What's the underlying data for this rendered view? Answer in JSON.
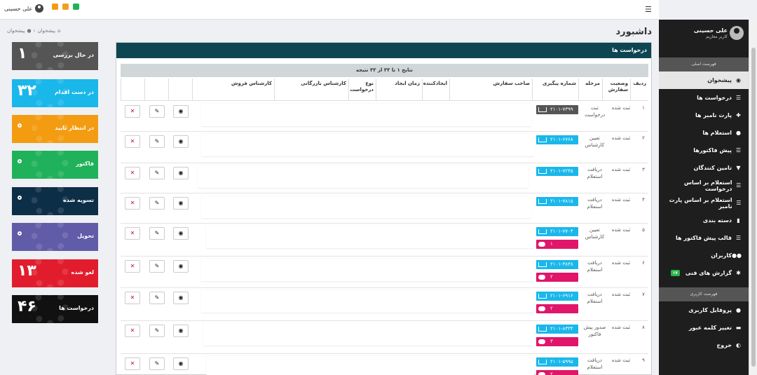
{
  "topbar": {
    "user_name": "علی حسینی"
  },
  "header": {
    "page_title": "داشبورد",
    "breadcrumb": [
      "پیشخوان",
      "پیشخوان"
    ]
  },
  "sidebar": {
    "user_name": "علی حسینی",
    "user_role": "کاربر معازیم",
    "section_main": "فهرست اصلی",
    "section_user": "فهرست کاربری",
    "items": [
      {
        "label": "پیشخوان",
        "icon": "dashboard-icon"
      },
      {
        "label": "درخواست ها",
        "icon": "list-icon"
      },
      {
        "label": "پارت نامبر ها",
        "icon": "puzzle-icon"
      },
      {
        "label": "استعلام ها",
        "icon": "user-icon"
      },
      {
        "label": "پیش فاکتورها",
        "icon": "list-icon"
      },
      {
        "label": "تامین کنندگان",
        "icon": "shop-icon"
      },
      {
        "label": "استعلام بر اساس درخواست",
        "icon": "list-icon"
      },
      {
        "label": "استعلام بر اساس پارت نامبر",
        "icon": "list-icon"
      },
      {
        "label": "دسته بندی",
        "icon": "book-icon"
      },
      {
        "label": "قالب پیش فاکتور ها",
        "icon": "list-icon"
      },
      {
        "label": "کاربران",
        "icon": "users-icon"
      },
      {
        "label": "گزارش های فنی",
        "icon": "bug-icon",
        "badge": "۱۷"
      }
    ],
    "user_items": [
      {
        "label": "پروفایل کاربری",
        "icon": "user-icon"
      },
      {
        "label": "تغییر کلمه عبور",
        "icon": "lock-icon"
      },
      {
        "label": "خروج",
        "icon": "logout-icon"
      }
    ]
  },
  "tiles": [
    {
      "label": "در حال بررسی",
      "value": "۱",
      "color": "#555555"
    },
    {
      "label": "در دست اقدام",
      "value": "۳۲",
      "color": "#1ab7ea"
    },
    {
      "label": "در انتظار تایید",
      "value": "",
      "color": "#f39c12"
    },
    {
      "label": "فاکتور",
      "value": "",
      "color": "#20b25a"
    },
    {
      "label": "تسویه شده",
      "value": "",
      "color": "#0d2e47"
    },
    {
      "label": "تحویل",
      "value": "",
      "color": "#605ca8"
    },
    {
      "label": "لغو شده",
      "value": "۱۳",
      "color": "#e11d2d"
    },
    {
      "label": "درخواست ها",
      "value": "۴۶",
      "color": "#111111"
    }
  ],
  "panel": {
    "title": "درخواست ها",
    "results": "نتایج ۱ تا ۳۳ از ۳۳ نتیجه",
    "columns": [
      "ردیف",
      "وضعیت سفارش",
      "مرحله",
      "شماره پیگیری",
      "صاحب سفارش",
      "ایجادکننده",
      "زمان ایجاد",
      "نوع درخواست",
      "کارشناس بازرگانی",
      "کارشناس فروش",
      "",
      "",
      ""
    ],
    "rows": [
      {
        "n": "۱",
        "status": "ثبت شده",
        "stage": "ثبت درخواست",
        "tracking": "۲۱۰۱-۷۳۹۹",
        "track_color": "#555555",
        "messages": ""
      },
      {
        "n": "۲",
        "status": "ثبت شده",
        "stage": "تعیین کارشناس",
        "tracking": "۲۱۰۱-۶۷۶۸",
        "track_color": "#1ab7ea",
        "messages": ""
      },
      {
        "n": "۳",
        "status": "ثبت شده",
        "stage": "دریافت استعلام",
        "tracking": "۲۱۰۱-۷۲۴۵",
        "track_color": "#1ab7ea",
        "messages": ""
      },
      {
        "n": "۴",
        "status": "ثبت شده",
        "stage": "دریافت استعلام",
        "tracking": "۲۱۰۱-۷۸۱۵",
        "track_color": "#1ab7ea",
        "messages": ""
      },
      {
        "n": "۵",
        "status": "ثبت شده",
        "stage": "تعیین کارشناس",
        "tracking": "۲۱۰۱-۷۷۰۴",
        "track_color": "#1ab7ea",
        "messages": "۱"
      },
      {
        "n": "۶",
        "status": "ثبت شده",
        "stage": "دریافت استعلام",
        "tracking": "۲۱۰۱-۳۸۳۸",
        "track_color": "#1ab7ea",
        "messages": "۲"
      },
      {
        "n": "۷",
        "status": "ثبت شده",
        "stage": "دریافت استعلام",
        "tracking": "۲۱۰۱-۶۹۱۶",
        "track_color": "#1ab7ea",
        "messages": "۲"
      },
      {
        "n": "۸",
        "status": "ثبت شده",
        "stage": "صدور پیش فاکتور",
        "tracking": "۲۱۰۱-۸۳۳۴",
        "track_color": "#1ab7ea",
        "messages": "۳"
      },
      {
        "n": "۹",
        "status": "ثبت شده",
        "stage": "دریافت استعلام",
        "tracking": "۲۱۰۱-۵۹۹۵",
        "track_color": "#1ab7ea",
        "messages": "۲"
      }
    ]
  }
}
